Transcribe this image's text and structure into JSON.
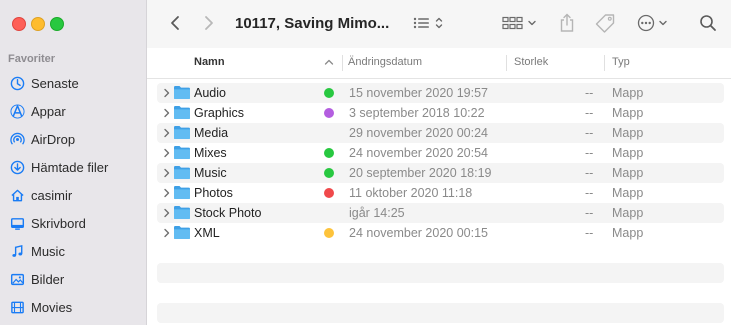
{
  "window": {
    "title": "10117, Saving Mimo..."
  },
  "sidebar": {
    "section": "Favoriter",
    "items": [
      {
        "label": "Senaste",
        "icon": "clock-icon"
      },
      {
        "label": "Appar",
        "icon": "apps-icon"
      },
      {
        "label": "AirDrop",
        "icon": "airdrop-icon"
      },
      {
        "label": "Hämtade filer",
        "icon": "download-icon"
      },
      {
        "label": "casimir",
        "icon": "home-icon"
      },
      {
        "label": "Skrivbord",
        "icon": "desktop-icon"
      },
      {
        "label": "Music",
        "icon": "music-icon"
      },
      {
        "label": "Bilder",
        "icon": "pictures-icon"
      },
      {
        "label": "Movies",
        "icon": "movies-icon"
      }
    ]
  },
  "columns": {
    "name": "Namn",
    "date": "Ändringsdatum",
    "size": "Storlek",
    "type": "Typ"
  },
  "files": [
    {
      "name": "Audio",
      "tag": "#28c840",
      "date": "15 november 2020 19:57",
      "size": "--",
      "type": "Mapp"
    },
    {
      "name": "Graphics",
      "tag": "#b45ee0",
      "date": "3 september 2018 10:22",
      "size": "--",
      "type": "Mapp"
    },
    {
      "name": "Media",
      "tag": "",
      "date": "29 november 2020 00:24",
      "size": "--",
      "type": "Mapp"
    },
    {
      "name": "Mixes",
      "tag": "#28c840",
      "date": "24 november 2020 20:54",
      "size": "--",
      "type": "Mapp"
    },
    {
      "name": "Music",
      "tag": "#28c840",
      "date": "20 september 2020 18:19",
      "size": "--",
      "type": "Mapp"
    },
    {
      "name": "Photos",
      "tag": "#f0494b",
      "date": "11 oktober 2020 11:18",
      "size": "--",
      "type": "Mapp"
    },
    {
      "name": "Stock Photo",
      "tag": "",
      "date": "igår 14:25",
      "size": "--",
      "type": "Mapp"
    },
    {
      "name": "XML",
      "tag": "#fdc33b",
      "date": "24 november 2020 00:15",
      "size": "--",
      "type": "Mapp"
    }
  ],
  "colors": {
    "accent": "#1a7cf5",
    "folder": "#57b5ef"
  }
}
